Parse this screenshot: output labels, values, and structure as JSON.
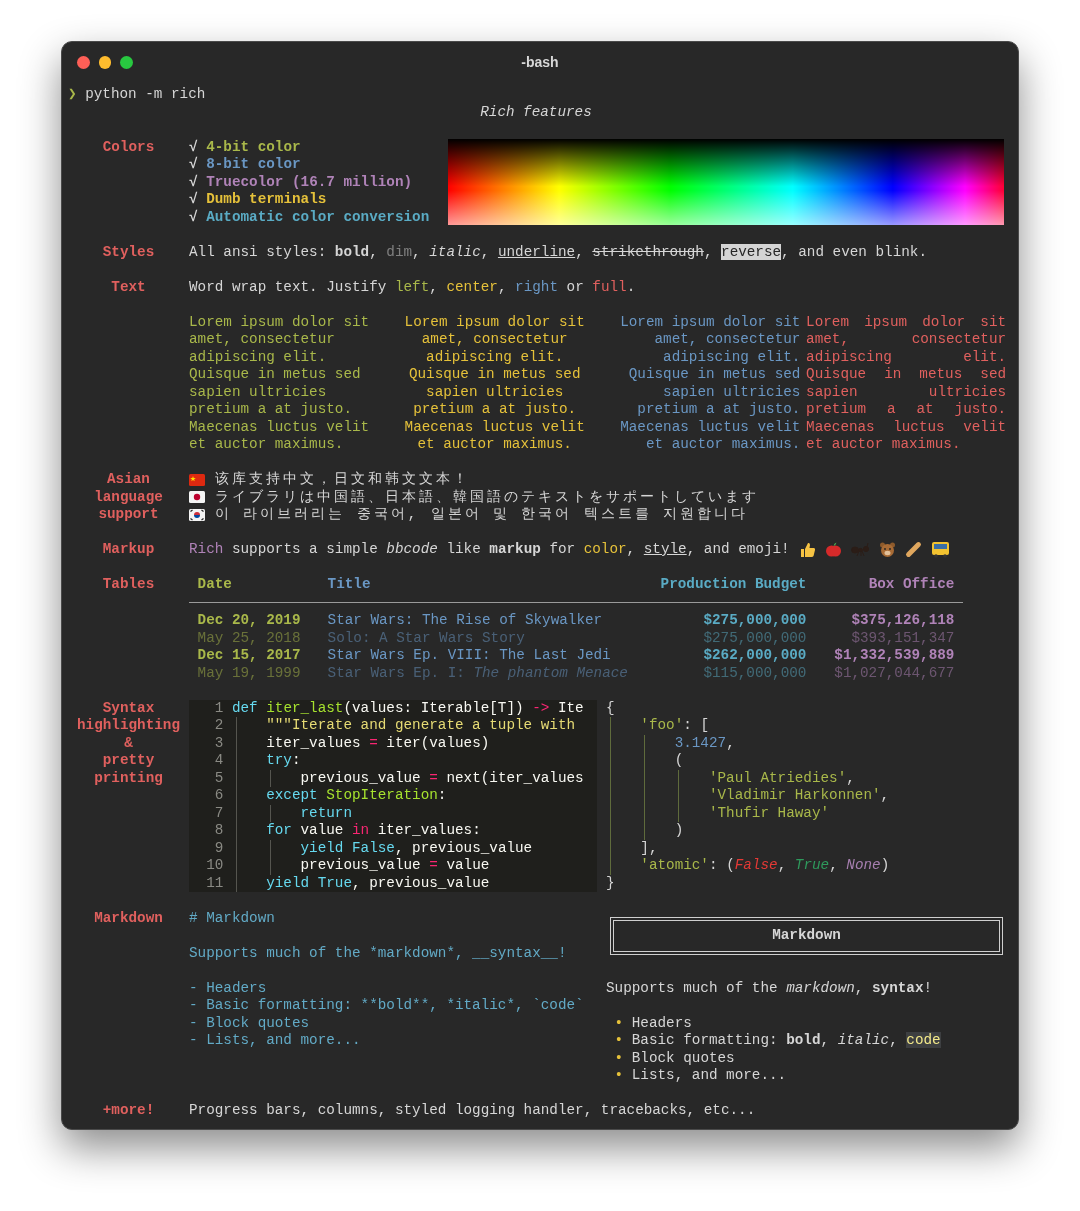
{
  "window": {
    "title": "-bash"
  },
  "prompt": {
    "symbol": "❯",
    "command": "python -m rich"
  },
  "heading": "Rich features",
  "colors": {
    "label": "Colors",
    "check": "√",
    "items": [
      {
        "text": "4-bit color",
        "color": "#a9b84a"
      },
      {
        "text": "8-bit color",
        "color": "#6a97c4"
      },
      {
        "text": "Truecolor (16.7 million)",
        "color": "#b083b8"
      },
      {
        "text": "Dumb terminals",
        "color": "#e5c13a"
      },
      {
        "text": "Automatic color conversion",
        "color": "#5aabc4"
      }
    ]
  },
  "styles": {
    "label": "Styles",
    "segments": [
      {
        "text": "All ansi styles: "
      },
      {
        "text": "bold",
        "kind": "bold"
      },
      {
        "text": ", "
      },
      {
        "text": "dim",
        "kind": "dim"
      },
      {
        "text": ", "
      },
      {
        "text": "italic",
        "kind": "italic"
      },
      {
        "text": ", "
      },
      {
        "text": "underline",
        "kind": "underline"
      },
      {
        "text": ", "
      },
      {
        "text": "strikethrough",
        "kind": "strike"
      },
      {
        "text": ", "
      },
      {
        "text": "reverse",
        "kind": "reverse"
      },
      {
        "text": ", and even blink."
      }
    ]
  },
  "text": {
    "label": "Text",
    "segments": [
      {
        "text": "Word wrap text. Justify "
      },
      {
        "text": "left",
        "color": "#a9b84a"
      },
      {
        "text": ", "
      },
      {
        "text": "center",
        "color": "#e5c13a"
      },
      {
        "text": ", "
      },
      {
        "text": "right",
        "color": "#6a97c4"
      },
      {
        "text": " or "
      },
      {
        "text": "full",
        "color": "#e0605e"
      },
      {
        "text": "."
      }
    ],
    "columns": [
      {
        "kind": "left",
        "color": "#a9b84a",
        "lines": [
          "Lorem ipsum dolor sit",
          "amet, consectetur",
          "adipiscing elit.",
          "Quisque in metus sed",
          "sapien ultricies",
          "pretium a at justo.",
          "Maecenas luctus velit",
          "et auctor maximus."
        ]
      },
      {
        "kind": "center",
        "color": "#e5c13a",
        "lines": [
          "Lorem ipsum dolor sit",
          "amet, consectetur",
          "adipiscing elit.",
          "Quisque in metus sed",
          "sapien ultricies",
          "pretium a at justo.",
          "Maecenas luctus velit",
          "et auctor maximus."
        ]
      },
      {
        "kind": "right",
        "color": "#6a97c4",
        "lines": [
          "Lorem ipsum dolor sit",
          "amet, consectetur",
          "adipiscing elit.",
          "Quisque in metus sed",
          "sapien ultricies",
          "pretium a at justo.",
          "Maecenas luctus velit",
          "et auctor maximus."
        ]
      },
      {
        "kind": "full",
        "color": "#e0605e",
        "lines": [
          "Lorem ipsum dolor sit",
          "amet, consectetur",
          "adipiscing elit.",
          "Quisque in metus sed",
          "sapien ultricies",
          "pretium a at justo.",
          "Maecenas luctus velit",
          "et auctor maximus."
        ]
      }
    ]
  },
  "asian": {
    "label": "Asian\nlanguage\nsupport",
    "lines": [
      {
        "kind": "china",
        "text": "该库支持中文，日文和韩文文本！"
      },
      {
        "kind": "japan",
        "text": "ライブラリは中国語、日本語、韓国語のテキストをサポートしています"
      },
      {
        "kind": "korea",
        "text": "이 라이브러리는 중국어, 일본어 및 한국어 텍스트를 지원합니다"
      }
    ]
  },
  "markup": {
    "label": "Markup",
    "segments": [
      {
        "text": "Rich",
        "color": "#b083b8"
      },
      {
        "text": " supports a simple "
      },
      {
        "text": "bbcode",
        "kind": "italic"
      },
      {
        "text": " like "
      },
      {
        "text": "markup",
        "kind": "bold"
      },
      {
        "text": " for "
      },
      {
        "text": "color",
        "color": "#e5c13a"
      },
      {
        "text": ", "
      },
      {
        "text": "style",
        "kind": "underline"
      },
      {
        "text": ", and emoji!"
      }
    ]
  },
  "table": {
    "label": "Tables",
    "columns": [
      {
        "title": "Date",
        "color": "#a9b84a",
        "kind": "date"
      },
      {
        "title": "Title",
        "color": "#6a97c4",
        "kind": "title"
      },
      {
        "title": "Production Budget",
        "color": "#5aabc4",
        "kind": "money"
      },
      {
        "title": "Box Office",
        "color": "#b083b8",
        "kind": "money"
      }
    ],
    "rows": [
      {
        "dim": false,
        "cells": [
          "Dec 20, 2019",
          "Star Wars: The Rise of Skywalker",
          "$275,000,000",
          "$375,126,118"
        ]
      },
      {
        "dim": true,
        "cells": [
          "May 25, 2018",
          "Solo: A Star Wars Story",
          "$275,000,000",
          "$393,151,347"
        ]
      },
      {
        "dim": false,
        "cells": [
          "Dec 15, 2017",
          "Star Wars Ep. VIII: The Last Jedi",
          "$262,000,000",
          "$1,332,539,889"
        ]
      },
      {
        "dim": true,
        "cells": [
          "May 19, 1999",
          "Star Wars Ep. I: *The phantom Menace*",
          "$115,000,000",
          "$1,027,044,677"
        ]
      }
    ]
  },
  "syntax": {
    "label": "Syntax\nhighlighting\n&\npretty\nprinting",
    "code": [
      {
        "number": "1",
        "segments": [
          {
            "text": "def",
            "color": "#66d9ef"
          },
          {
            "text": " iter_last",
            "color": "#a6e22e"
          },
          {
            "text": "(values: Iterable[T]) "
          },
          {
            "text": "->",
            "color": "#f92672"
          },
          {
            "text": " Ite"
          }
        ]
      },
      {
        "number": "2",
        "segments": [
          {
            "text": "    \"\"\"Iterate and generate a tuple with",
            "color": "#e6db74"
          }
        ]
      },
      {
        "number": "3",
        "segments": [
          {
            "text": "    iter_values "
          },
          {
            "text": "=",
            "color": "#f92672"
          },
          {
            "text": " iter(values)"
          }
        ]
      },
      {
        "number": "4",
        "segments": [
          {
            "text": "    try",
            "color": "#66d9ef"
          },
          {
            "text": ":"
          }
        ]
      },
      {
        "number": "5",
        "segments": [
          {
            "text": "        previous_value "
          },
          {
            "text": "=",
            "color": "#f92672"
          },
          {
            "text": " next(iter_values"
          }
        ]
      },
      {
        "number": "6",
        "segments": [
          {
            "text": "    except",
            "color": "#66d9ef"
          },
          {
            "text": " StopIteration",
            "color": "#a6e22e"
          },
          {
            "text": ":"
          }
        ]
      },
      {
        "number": "7",
        "segments": [
          {
            "text": "        return",
            "color": "#66d9ef"
          }
        ]
      },
      {
        "number": "8",
        "segments": [
          {
            "text": "    for",
            "color": "#66d9ef"
          },
          {
            "text": " value "
          },
          {
            "text": "in",
            "color": "#f92672"
          },
          {
            "text": " iter_values:"
          }
        ]
      },
      {
        "number": "9",
        "segments": [
          {
            "text": "        yield",
            "color": "#66d9ef"
          },
          {
            "text": " False",
            "color": "#66d9ef"
          },
          {
            "text": ", previous_value"
          }
        ]
      },
      {
        "number": "10",
        "segments": [
          {
            "text": "        previous_value "
          },
          {
            "text": "=",
            "color": "#f92672"
          },
          {
            "text": " value"
          }
        ]
      },
      {
        "number": "11",
        "segments": [
          {
            "text": "    yield",
            "color": "#66d9ef"
          },
          {
            "text": " True",
            "color": "#66d9ef"
          },
          {
            "text": ", previous_value"
          }
        ]
      }
    ],
    "pretty": [
      {
        "segments": [
          {
            "text": "{"
          }
        ]
      },
      {
        "segments": [
          {
            "text": "    'foo'",
            "color": "#a9b84a"
          },
          {
            "text": ": ["
          }
        ]
      },
      {
        "segments": [
          {
            "text": "        3.1427",
            "color": "#6a97c4"
          },
          {
            "text": ","
          }
        ]
      },
      {
        "segments": [
          {
            "text": "        ("
          }
        ]
      },
      {
        "segments": [
          {
            "text": "            'Paul Atriedies'",
            "color": "#a9b84a"
          },
          {
            "text": ","
          }
        ]
      },
      {
        "segments": [
          {
            "text": "            'Vladimir Harkonnen'",
            "color": "#a9b84a"
          },
          {
            "text": ","
          }
        ]
      },
      {
        "segments": [
          {
            "text": "            'Thufir Haway'",
            "color": "#a9b84a"
          }
        ]
      },
      {
        "segments": [
          {
            "text": "        )"
          }
        ]
      },
      {
        "segments": [
          {
            "text": "    ],"
          }
        ]
      },
      {
        "segments": [
          {
            "text": "    'atomic'",
            "color": "#a9b84a"
          },
          {
            "text": ": ("
          },
          {
            "text": "False",
            "kind": "italic",
            "color": "#e53935"
          },
          {
            "text": ", "
          },
          {
            "text": "True",
            "kind": "italic",
            "color": "#2e9a5c"
          },
          {
            "text": ", "
          },
          {
            "text": "None",
            "kind": "italic",
            "color": "#a77fb0"
          },
          {
            "text": ")"
          }
        ]
      },
      {
        "segments": [
          {
            "text": "}"
          }
        ]
      }
    ]
  },
  "markdown": {
    "label": "Markdown",
    "source": {
      "heading": "# Markdown",
      "paragraph": "Supports much of the *markdown*, __syntax__!",
      "list": [
        "- Headers",
        "- Basic formatting: **bold**, *italic*, `code`",
        "- Block quotes",
        "- Lists, and more..."
      ]
    },
    "rendered": {
      "title": "Markdown",
      "paragraph": [
        {
          "text": "Supports much of the "
        },
        {
          "text": "markdown",
          "kind": "italic"
        },
        {
          "text": ", "
        },
        {
          "text": "syntax",
          "kind": "bold"
        },
        {
          "text": "!"
        }
      ],
      "bullet": "•",
      "items": [
        {
          "segments": [
            {
              "text": "Headers"
            }
          ]
        },
        {
          "segments": [
            {
              "text": "Basic formatting: "
            },
            {
              "text": "bold",
              "kind": "bold"
            },
            {
              "text": ", "
            },
            {
              "text": "italic",
              "kind": "italic"
            },
            {
              "text": ", "
            },
            {
              "text": "code",
              "kind": "code"
            }
          ]
        },
        {
          "segments": [
            {
              "text": "Block quotes"
            }
          ]
        },
        {
          "segments": [
            {
              "text": "Lists, and more..."
            }
          ]
        }
      ]
    }
  },
  "more": {
    "label": "+more!",
    "text": "Progress bars, columns, styled logging handler, tracebacks, etc..."
  }
}
